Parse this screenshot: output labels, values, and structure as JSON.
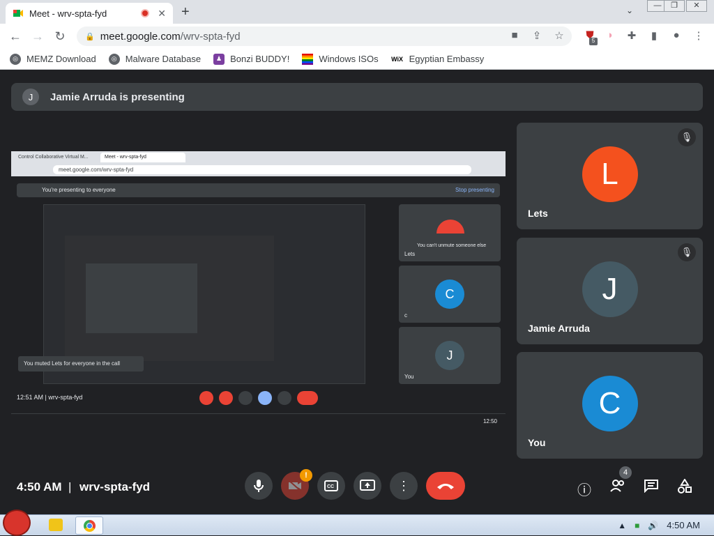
{
  "browser": {
    "tab_title": "Meet - wrv-spta-fyd",
    "url_host": "meet.google.com",
    "url_path": "/wrv-spta-fyd",
    "bookmarks": [
      {
        "label": "MEMZ Download",
        "icon": "globe-icon"
      },
      {
        "label": "Malware Database",
        "icon": "globe-icon"
      },
      {
        "label": "Bonzi BUDDY!",
        "icon": "bonzi-icon"
      },
      {
        "label": "Windows ISOs",
        "icon": "rainbow-flag-icon"
      },
      {
        "label": "Egyptian Embassy",
        "icon": "wix-icon"
      }
    ],
    "ext_badge": "5"
  },
  "meet": {
    "presenting_avatar": "J",
    "presenting_text": "Jamie Arruda is presenting",
    "time": "4:50 AM",
    "separator": "|",
    "meeting_code": "wrv-spta-fyd",
    "participant_count": "4",
    "warn_badge": "!",
    "participants": [
      {
        "initial": "L",
        "name": "Lets",
        "color": "#f4511e",
        "muted": true
      },
      {
        "initial": "J",
        "name": "Jamie Arruda",
        "color": "#455a64",
        "muted": true
      },
      {
        "initial": "C",
        "name": "You",
        "color": "#1a8bd4",
        "muted": false
      }
    ]
  },
  "shared_screen": {
    "tab_a": "Control Collaborative Virtual M...",
    "tab_b": "Meet - wrv-spta-fyd",
    "url": "meet.google.com/wrv-spta-fyd",
    "presenting_text": "You're presenting to everyone",
    "stop_text": "Stop presenting",
    "time_code": "12:51 AM  |  wrv-spta-fyd",
    "toast": "You muted Lets for everyone in the call",
    "tile_lets_caption": "You can't unmute someone else",
    "tiles": [
      {
        "initial": "",
        "name": "Lets",
        "color": "#ea4335"
      },
      {
        "initial": "C",
        "name": "c",
        "color": "#1a8bd4"
      },
      {
        "initial": "J",
        "name": "You",
        "color": "#455a64"
      }
    ],
    "clock": "12:50"
  },
  "taskbar": {
    "clock": "4:50 AM"
  }
}
